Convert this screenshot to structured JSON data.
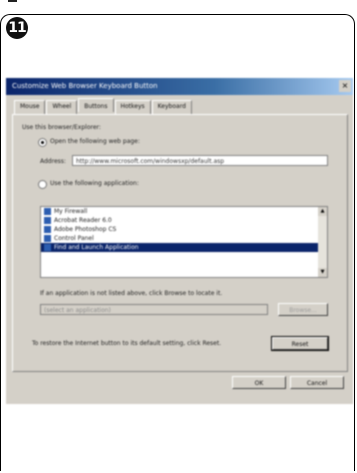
{
  "step": {
    "number": "11"
  },
  "dialog": {
    "title": "Customize Web Browser Keyboard Button",
    "close_glyph": "×",
    "tabs": [
      "Mouse",
      "Wheel",
      "Buttons",
      "Hotkeys",
      "Keyboard"
    ],
    "active_tab": 2,
    "group_label": "Use this browser/Explorer:",
    "option_web_label": "Open the following web page:",
    "address_label": "Address:",
    "address_value": "http://www.microsoft.com/windowsxp/default.asp",
    "option_app_label": "Use the following application:",
    "apps": [
      {
        "label": "My Firewall",
        "selected": false
      },
      {
        "label": "Acrobat Reader 6.0",
        "selected": false
      },
      {
        "label": "Adobe Photoshop CS",
        "selected": false
      },
      {
        "label": "Control Panel",
        "selected": false
      },
      {
        "label": "Find and Launch Application",
        "selected": true
      }
    ],
    "browse_hint": "If an application is not listed above, click Browse to locate it.",
    "app_path_placeholder": "(select an application)",
    "browse_button": "Browse...",
    "restore_hint": "To restore the Internet button to its default setting, click Reset.",
    "reset_button": "Reset",
    "ok_button": "OK",
    "cancel_button": "Cancel"
  },
  "colors": {
    "titlebar_start": "#0a246a",
    "titlebar_end": "#a6caf0",
    "dialog_face": "#d4d0c8",
    "selection": "#0a246a"
  }
}
